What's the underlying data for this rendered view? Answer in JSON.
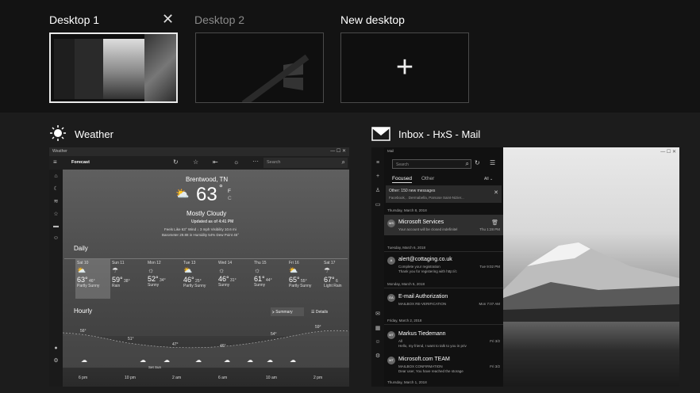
{
  "desktops": {
    "d1_label": "Desktop 1",
    "d2_label": "Desktop 2",
    "new_label": "New desktop"
  },
  "windows": {
    "weather_title": "Weather",
    "mail_title": "Inbox - HxS - Mail"
  },
  "weather": {
    "app_name": "Weather",
    "section": "Forecast",
    "search_placeholder": "Search",
    "city": "Brentwood, TN",
    "temp": "63",
    "unit_f": "F",
    "unit_c": "C",
    "condition": "Mostly Cloudy",
    "updated": "Updated as of 4:41 PM",
    "details1": "Feels Like  63°    Wind  ↓ 3 mph    Visibility  10.6 mi",
    "details2": "Barometer  29.88 in    Humidity  54%    Dew Point  45°",
    "daily_label": "Daily",
    "days": [
      {
        "day": "Sat 10",
        "hi": "63°",
        "lo": "46°",
        "cond": "Partly Sunny",
        "icon": "partly-sunny"
      },
      {
        "day": "Sun 11",
        "hi": "59°",
        "lo": "38°",
        "cond": "Rain",
        "icon": "rain"
      },
      {
        "day": "Mon 12",
        "hi": "52°",
        "lo": "34°",
        "cond": "Sunny",
        "icon": "sunny"
      },
      {
        "day": "Tue 13",
        "hi": "46°",
        "lo": "25°",
        "cond": "Partly Sunny",
        "icon": "partly-sunny"
      },
      {
        "day": "Wed 14",
        "hi": "46°",
        "lo": "31°",
        "cond": "Sunny",
        "icon": "sunny"
      },
      {
        "day": "Thu 15",
        "hi": "61°",
        "lo": "44°",
        "cond": "Sunny",
        "icon": "sunny"
      },
      {
        "day": "Fri 16",
        "hi": "65°",
        "lo": "55°",
        "cond": "Partly Sunny",
        "icon": "partly-sunny"
      },
      {
        "day": "Sat 17",
        "hi": "67°",
        "lo": "6",
        "cond": "Light Rain",
        "icon": "light-rain"
      }
    ],
    "hourly_label": "Hourly",
    "summary_btn": "Summary",
    "details_btn": "Details",
    "hourly_temps": [
      "56°",
      "51°",
      "47°",
      "46°",
      "54°",
      "59°"
    ],
    "hourly_times": [
      "6 pm",
      "10 pm",
      "2 am",
      "6 am",
      "10 am",
      "2 pm"
    ],
    "hourly_note": "Set  Sun"
  },
  "mail": {
    "app_name": "Mail",
    "search_placeholder": "Search",
    "tab_focused": "Focused",
    "tab_other": "Other",
    "filter": "All",
    "other_banner": "Other: 150 new messages",
    "other_banner_sub": "Facebook, . Dermabella, Parsose Saint-Nizier...",
    "groups": {
      "g1": "Thursday, March 8, 2018",
      "g2": "Tuesday, March 6, 2018",
      "g3": "Monday, March 5, 2018",
      "g4": "Friday, March 2, 2018",
      "g5": "Thursday, March 1, 2018"
    },
    "items": [
      {
        "initials": "MS",
        "name": "Microsoft Services",
        "sub": "Your account will be closed indefinitel",
        "date": "Thu 1:28 PM"
      },
      {
        "initials": "A",
        "name": "alert@cottaging.co.uk",
        "sub": "Complete your registration",
        "sub2": "Thank you for registering with http://c",
        "date": "Tue 9:02 PM"
      },
      {
        "initials": "EA",
        "name": "E-mail Authorization",
        "sub": "MAILBOX RE-VERIFICATION",
        "date": "Mon 7:07 AM"
      },
      {
        "initials": "MT",
        "name": "Markus Tiedemann",
        "sub": "All",
        "sub2": "Hello, my friend, I want to talk to you in priv",
        "date": "Fri 3/2"
      },
      {
        "initials": "MT",
        "name": "Microsoft.com TEAM",
        "sub": "MAILBOX CONFIRMATION",
        "sub2": "Dear user,    You have reached the storage",
        "date": "Fri 3/2"
      }
    ]
  }
}
